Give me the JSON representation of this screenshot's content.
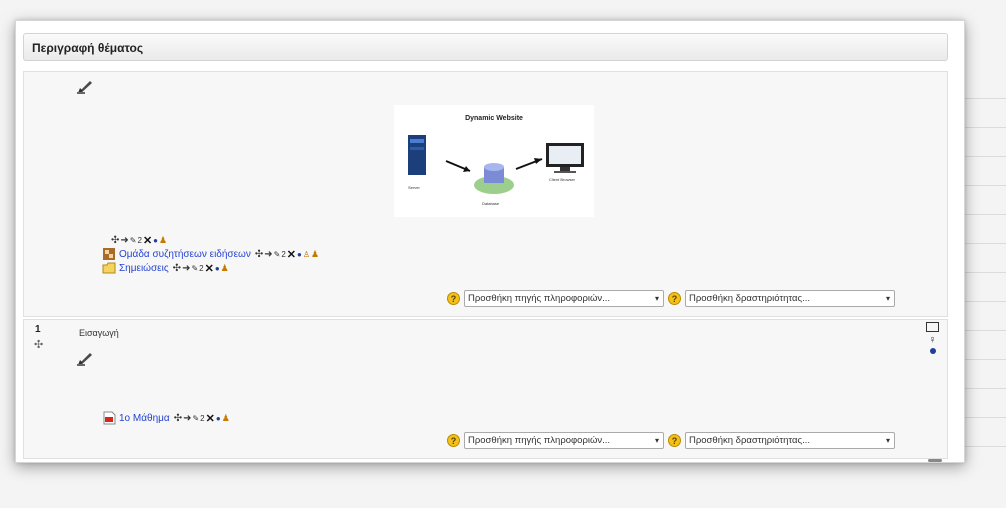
{
  "header": {
    "title": "Περιγραφή θέματος"
  },
  "section0": {
    "image": {
      "title": "Dynamic Website",
      "labels": {
        "server": "Server",
        "database": "Database",
        "client": "Client Browser"
      }
    },
    "activities": [
      {
        "label": "Ομάδα συζητήσεων ειδήσεων"
      },
      {
        "label": "Σημειώσεις"
      }
    ],
    "add_resource": "Προσθήκη πηγής πληροφοριών...",
    "add_activity": "Προσθήκη δραστηριότητας..."
  },
  "section1": {
    "number": "1",
    "title": "Εισαγωγή",
    "activities": [
      {
        "label": "1ο Μάθημα"
      }
    ],
    "add_resource": "Προσθήκη πηγής πληροφοριών...",
    "add_activity": "Προσθήκη δραστηριότητας..."
  },
  "controls": {
    "indent_badge": "2",
    "help_symbol": "?",
    "move_symbol": "✣",
    "right_arrow": "➜",
    "delete_symbol": "✕",
    "caret": "▾"
  },
  "colors": {
    "link": "#2443d1",
    "help": "#f3c11a",
    "panel_bg": "#f7f7f7"
  }
}
